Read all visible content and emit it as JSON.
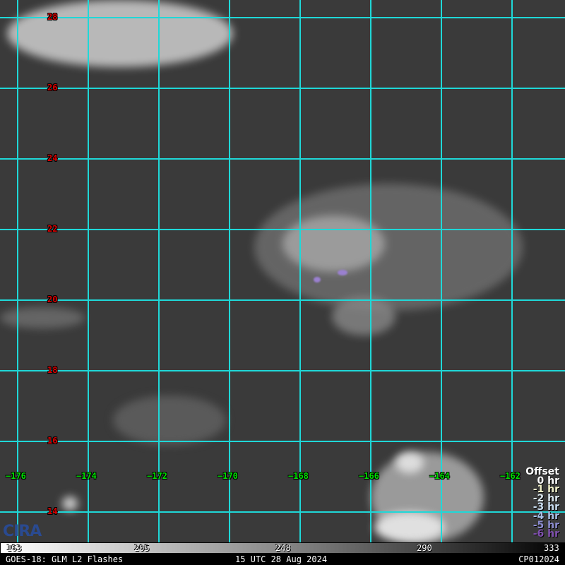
{
  "map": {
    "latitude_labels": [
      "28",
      "26",
      "24",
      "22",
      "20",
      "18",
      "16",
      "14"
    ],
    "longitude_labels": [
      "−176",
      "−174",
      "−172",
      "−170",
      "−168",
      "−166",
      "−164",
      "−162"
    ],
    "grid_color": "#1fd8d8"
  },
  "legend": {
    "title": "Offset",
    "items": [
      {
        "label": "0 hr",
        "color": "#ffffff"
      },
      {
        "label": "-1 hr",
        "color": "#f0f0c8"
      },
      {
        "label": "-2 hr",
        "color": "#dce8f0"
      },
      {
        "label": "-3 hr",
        "color": "#c8dcf0"
      },
      {
        "label": "-4 hr",
        "color": "#a8c0e8"
      },
      {
        "label": "-5 hr",
        "color": "#8c8cd0"
      },
      {
        "label": "-6 hr",
        "color": "#8050b0"
      }
    ]
  },
  "colorbar": {
    "ticks": [
      "163",
      "205",
      "248",
      "290",
      "333"
    ]
  },
  "footer": {
    "left": "GOES-18: GLM L2 Flashes",
    "center": "15 UTC 28 Aug 2024",
    "right": "CP012024"
  },
  "logo": {
    "text": "CIRA"
  }
}
